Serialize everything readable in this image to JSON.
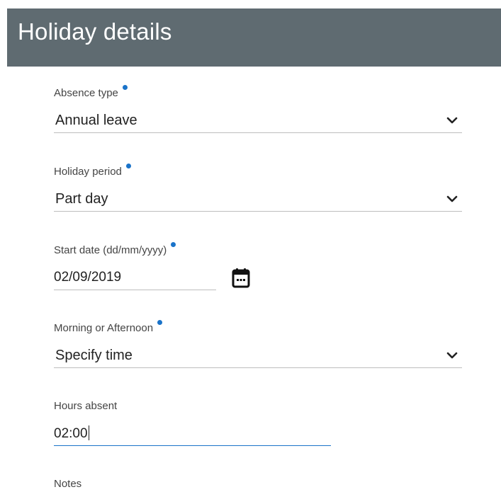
{
  "header": {
    "title": "Holiday details"
  },
  "form": {
    "absence_type": {
      "label": "Absence type",
      "value": "Annual leave"
    },
    "holiday_period": {
      "label": "Holiday period",
      "value": "Part day"
    },
    "start_date": {
      "label": "Start date (dd/mm/yyyy)",
      "value": "02/09/2019"
    },
    "morning_afternoon": {
      "label": "Morning or Afternoon",
      "value": "Specify time"
    },
    "hours_absent": {
      "label": "Hours absent",
      "value": "02:00"
    },
    "notes": {
      "label": "Notes"
    }
  },
  "colors": {
    "header_bg": "#5f6b71",
    "required_dot": "#1a73c9",
    "focus_underline": "#1a73c9"
  },
  "icons": {
    "dropdown": "chevron-down-icon",
    "calendar": "calendar-icon",
    "required": "required-dot-icon"
  }
}
